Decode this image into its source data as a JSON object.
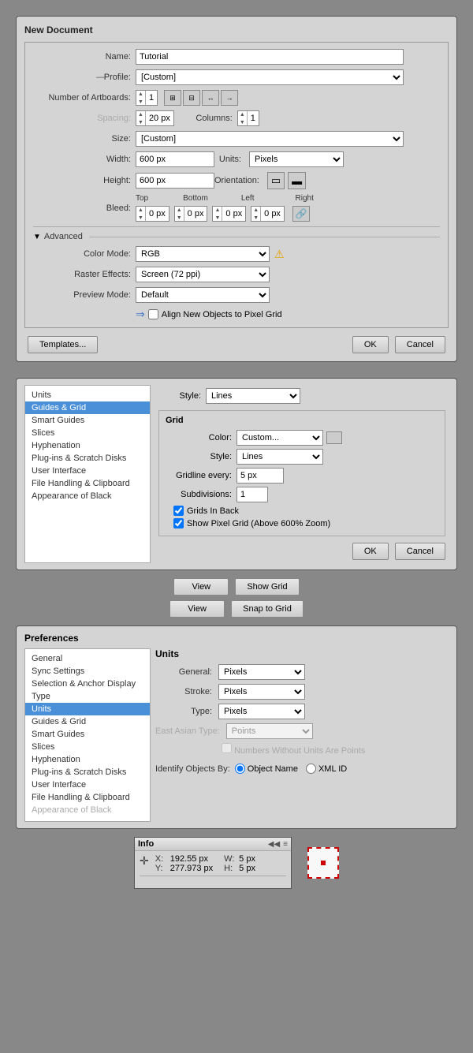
{
  "newDocument": {
    "title": "New Document",
    "fields": {
      "name_label": "Name:",
      "name_value": "Tutorial",
      "profile_label": "Profile:",
      "profile_value": "[Custom]",
      "artboards_label": "Number of Artboards:",
      "artboards_value": "1",
      "spacing_label": "Spacing:",
      "spacing_value": "20 px",
      "columns_label": "Columns:",
      "columns_value": "1",
      "size_label": "Size:",
      "size_value": "[Custom]",
      "width_label": "Width:",
      "width_value": "600 px",
      "units_label": "Units:",
      "units_value": "Pixels",
      "height_label": "Height:",
      "height_value": "600 px",
      "orientation_label": "Orientation:",
      "bleed_label": "Bleed:",
      "bleed_top_label": "Top",
      "bleed_top_value": "0 px",
      "bleed_bottom_label": "Bottom",
      "bleed_bottom_value": "0 px",
      "bleed_left_label": "Left",
      "bleed_left_value": "0 px",
      "bleed_right_label": "Right",
      "bleed_right_value": "0 px"
    },
    "advanced": {
      "label": "Advanced",
      "colormode_label": "Color Mode:",
      "colormode_value": "RGB",
      "raster_label": "Raster Effects:",
      "raster_value": "Screen (72 ppi)",
      "preview_label": "Preview Mode:",
      "preview_value": "Default",
      "pixel_grid_label": "Align New Objects to Pixel Grid"
    },
    "buttons": {
      "templates": "Templates...",
      "ok": "OK",
      "cancel": "Cancel"
    }
  },
  "prefsGuides": {
    "sidebar_items": [
      "Units",
      "Guides & Grid",
      "Smart Guides",
      "Slices",
      "Hyphenation",
      "Plug-ins & Scratch Disks",
      "User Interface",
      "File Handling & Clipboard",
      "Appearance of Black"
    ],
    "active_item": "Guides & Grid",
    "guides_section": {
      "style_label": "Style:",
      "style_value": "Lines",
      "color_label": "",
      "color_value": ""
    },
    "grid_section": {
      "title": "Grid",
      "color_label": "Color:",
      "color_value": "Custom...",
      "style_label": "Style:",
      "style_value": "Lines",
      "gridline_label": "Gridline every:",
      "gridline_value": "5 px",
      "subdivisions_label": "Subdivisions:",
      "subdivisions_value": "1",
      "grids_in_back": "Grids In Back",
      "show_pixel_grid": "Show Pixel Grid (Above 600% Zoom)"
    },
    "buttons": {
      "ok": "OK",
      "cancel": "Cancel"
    }
  },
  "midButtons": {
    "view_label": "View",
    "show_grid_label": "Show Grid",
    "snap_to_grid_label": "Snap to Grid"
  },
  "prefsUnits": {
    "title": "Preferences",
    "sidebar_items": [
      "General",
      "Sync Settings",
      "Selection & Anchor Display",
      "Type",
      "Units",
      "Guides & Grid",
      "Smart Guides",
      "Slices",
      "Hyphenation",
      "Plug-ins & Scratch Disks",
      "User Interface",
      "File Handling & Clipboard",
      "Appearance of Black"
    ],
    "active_item": "Units",
    "units_section": {
      "title": "Units",
      "general_label": "General:",
      "general_value": "Pixels",
      "stroke_label": "Stroke:",
      "stroke_value": "Pixels",
      "type_label": "Type:",
      "type_value": "Pixels",
      "east_asian_label": "East Asian Type:",
      "east_asian_value": "Points",
      "numbers_label": "Numbers Without Units Are Points",
      "identify_label": "Identify Objects By:",
      "object_name_label": "Object Name",
      "xml_id_label": "XML ID"
    }
  },
  "infoPanel": {
    "title": "Info",
    "x_label": "X:",
    "x_value": "192.55 px",
    "y_label": "Y:",
    "y_value": "277.973 px",
    "w_label": "W:",
    "w_value": "5 px",
    "h_label": "H:",
    "h_value": "5 px",
    "collapse_icon": "◀◀",
    "menu_icon": "≡"
  }
}
